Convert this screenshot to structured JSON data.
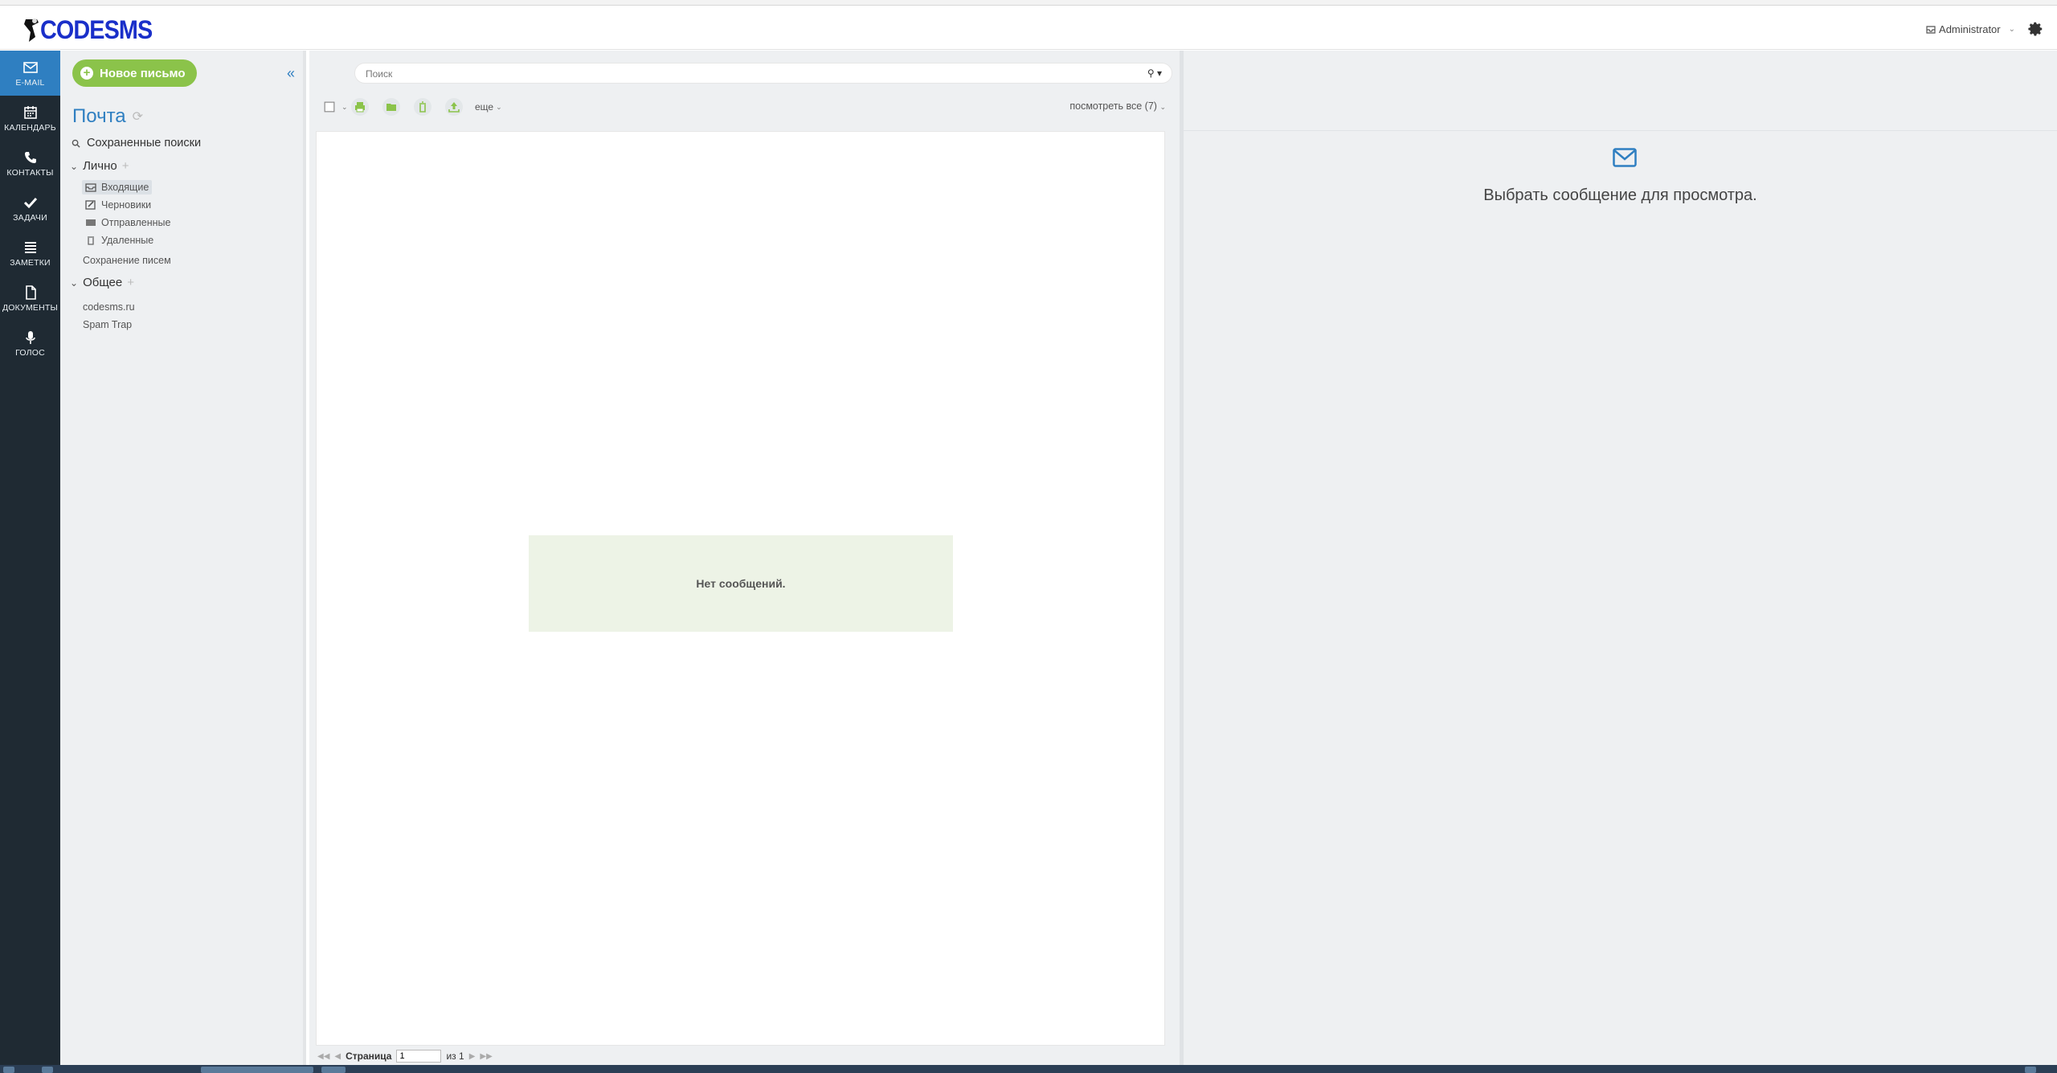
{
  "app": {
    "brand": "CODESMS"
  },
  "header": {
    "user_name": "Administrator"
  },
  "rail": {
    "items": [
      {
        "label": "E-MAIL",
        "icon": "envelope-icon"
      },
      {
        "label": "КАЛЕНДАРЬ",
        "icon": "calendar-icon"
      },
      {
        "label": "КОНТАКТЫ",
        "icon": "phone-icon"
      },
      {
        "label": "ЗАДАЧИ",
        "icon": "check-icon"
      },
      {
        "label": "ЗАМЕТКИ",
        "icon": "list-icon"
      },
      {
        "label": "ДОКУМЕНТЫ",
        "icon": "file-icon"
      },
      {
        "label": "ГОЛОС",
        "icon": "microphone-icon"
      }
    ]
  },
  "folders": {
    "new_message": "Новое письмо",
    "title": "Почта",
    "saved_searches": "Сохраненные поиски",
    "personal": {
      "label": "Лично",
      "items": [
        "Входящие",
        "Черновики",
        "Отправленные",
        "Удаленные"
      ],
      "archive": "Сохранение писем"
    },
    "shared": {
      "label": "Общее",
      "items": [
        "codesms.ru",
        "Spam Trap"
      ]
    }
  },
  "list": {
    "search_placeholder": "Поиск",
    "more": "еще",
    "view_all": "посмотреть все (7)",
    "empty": "Нет сообщений.",
    "pager": {
      "label": "Страница",
      "page": "1",
      "of": "из 1"
    }
  },
  "preview": {
    "hint": "Выбрать сообщение для просмотра."
  },
  "colors": {
    "accent": "#2f7fc1",
    "green": "#8bc34a",
    "rail": "#1f2a33"
  }
}
